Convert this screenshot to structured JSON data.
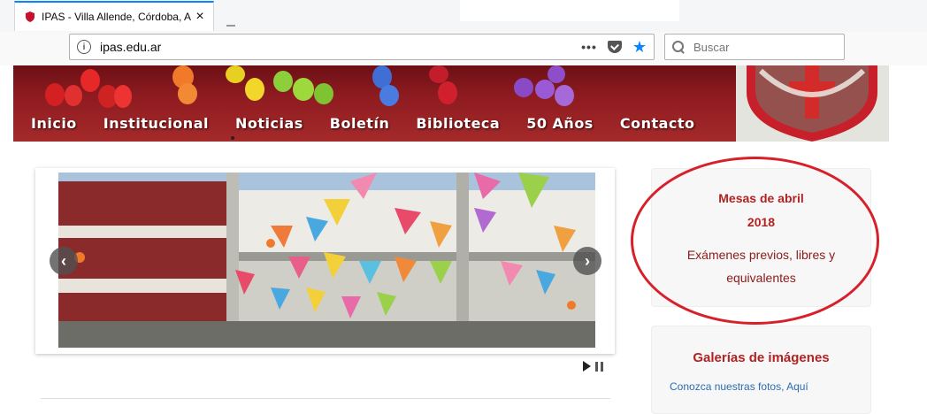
{
  "browser": {
    "tab_title": "IPAS - Villa Allende, Córdoba, A",
    "tab_close": "×",
    "url": "ipas.edu.ar",
    "info_glyph": "i",
    "dots": "•••",
    "star": "★",
    "search_placeholder": "Buscar"
  },
  "nav": {
    "items": [
      {
        "label": "Inicio"
      },
      {
        "label": "Institucional"
      },
      {
        "label": "Noticias"
      },
      {
        "label": "Boletín"
      },
      {
        "label": "Biblioteca"
      },
      {
        "label": "50 Años"
      },
      {
        "label": "Contacto"
      }
    ]
  },
  "slider": {
    "prev": "‹",
    "next": "›"
  },
  "sidebar": {
    "box1": {
      "title_line1": "Mesas de abril",
      "title_line2": "2018",
      "body_line1": "Exámenes previos, libres y",
      "body_line2": "equivalentes"
    },
    "box2": {
      "title": "Galerías de imágenes",
      "link": "Conozca nuestras fotos, Aquí"
    }
  },
  "colors": {
    "accent_tab": "#0a84ff",
    "header_red": "#8e1b20",
    "box_title": "#b22222",
    "highlight_ellipse": "#d8202b",
    "link_blue": "#2a6db0"
  }
}
